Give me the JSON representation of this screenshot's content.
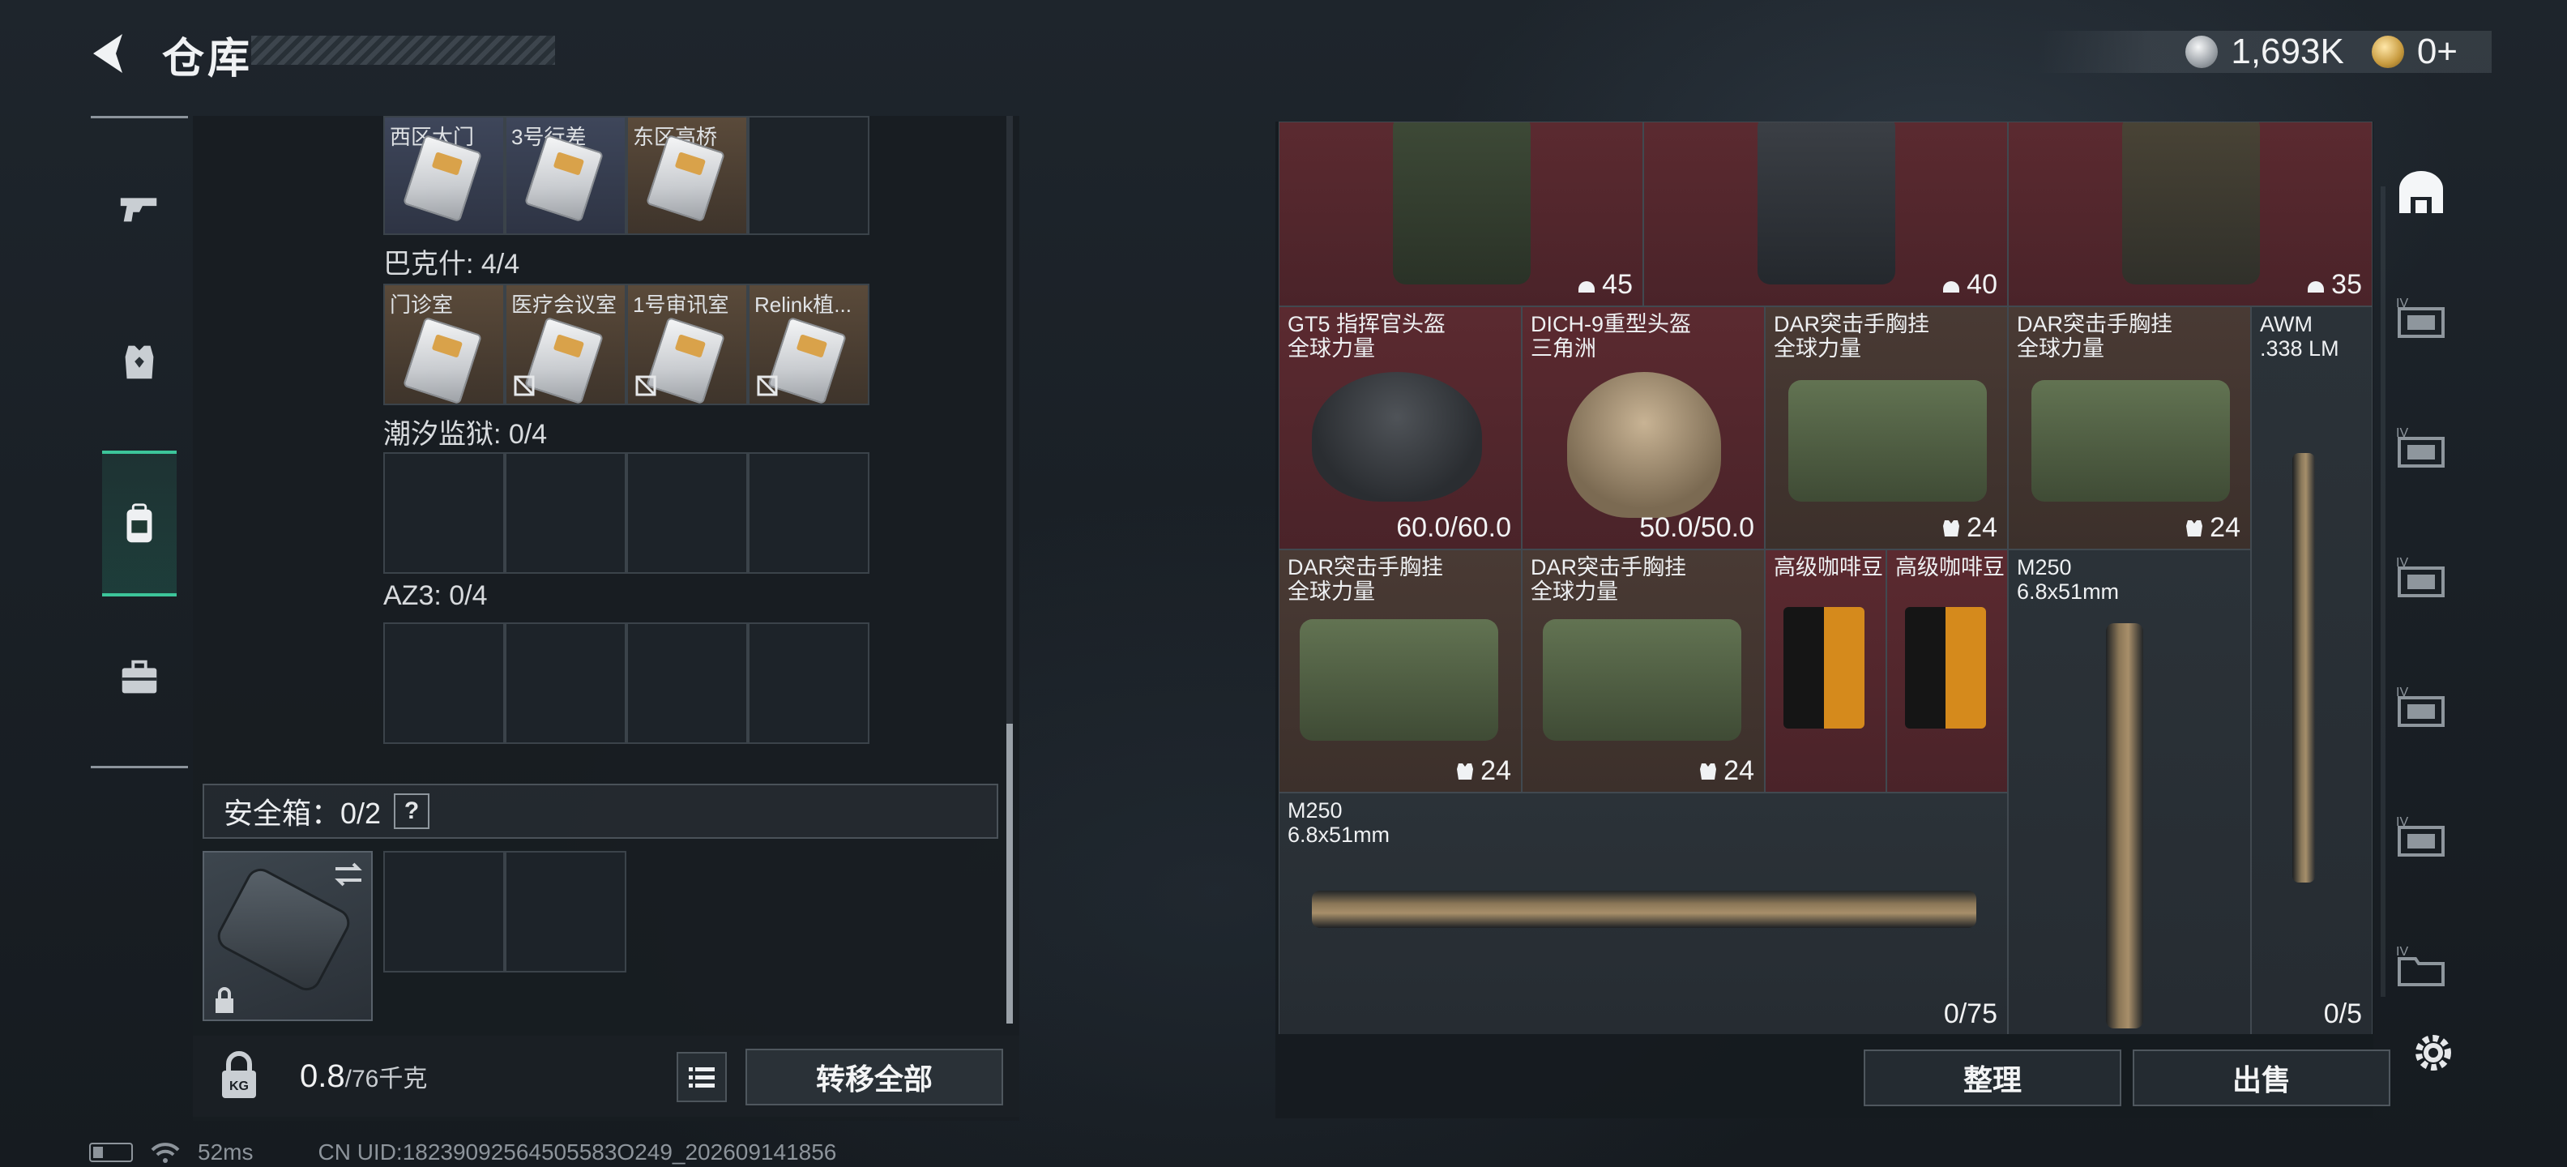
{
  "header": {
    "title": "仓库",
    "currency": [
      {
        "icon": "silver-coin-icon",
        "value": "1,693K"
      },
      {
        "icon": "gold-coin-icon",
        "value": "0+"
      }
    ]
  },
  "left_nav": [
    {
      "icon": "gun-icon",
      "active": false
    },
    {
      "icon": "armor-icon",
      "active": false
    },
    {
      "icon": "backpack-icon",
      "active": true
    },
    {
      "icon": "toolbox-icon",
      "active": false
    }
  ],
  "keys": {
    "row1": [
      "西区大门",
      "3号行差",
      "东区高桥",
      ""
    ],
    "bakesh": {
      "label": "巴克什: 4/4",
      "cards": [
        "门诊室",
        "医疗会议室",
        "1号审讯室",
        "Relink植..."
      ]
    },
    "prison": {
      "label": "潮汐监狱: 0/4"
    },
    "az3": {
      "label": "AZ3: 0/4"
    }
  },
  "safe": {
    "label": "安全箱：0/2",
    "help": "?"
  },
  "inventory": {
    "weight": "0.8",
    "weight_max": "/76千克",
    "transfer_all": "转移全部"
  },
  "grid": {
    "top_values": [
      "45",
      "40",
      "35"
    ],
    "items": [
      {
        "name": "GT5 指挥官头盔",
        "sub": "全球力量",
        "value": "60.0/60.0"
      },
      {
        "name": "DICH-9重型头盔",
        "sub": "三角洲",
        "value": "50.0/50.0"
      },
      {
        "name": "DAR突击手胸挂",
        "sub": "全球力量",
        "value": "24"
      },
      {
        "name": "DAR突击手胸挂",
        "sub": "全球力量",
        "value": "24"
      },
      {
        "name": "AWM",
        "sub": ".338 LM",
        "value": "0/5"
      },
      {
        "name": "DAR突击手胸挂",
        "sub": "全球力量",
        "value": "24"
      },
      {
        "name": "DAR突击手胸挂",
        "sub": "全球力量",
        "value": "24"
      },
      {
        "name": "高级咖啡豆",
        "sub": "",
        "value": ""
      },
      {
        "name": "高级咖啡豆",
        "sub": "",
        "value": ""
      },
      {
        "name": "M250",
        "sub": "6.8x51mm",
        "value": ""
      },
      {
        "name": "M250",
        "sub": "6.8x51mm",
        "value": "0/75"
      }
    ]
  },
  "right_nav": [
    "house-icon",
    "IV",
    "IV",
    "IV",
    "IV",
    "IV",
    "IV"
  ],
  "actions": {
    "sort": "整理",
    "sell": "出售"
  },
  "status": {
    "ping": "52ms",
    "uid": "CN UID:18239092564505583O249_202609141856"
  }
}
